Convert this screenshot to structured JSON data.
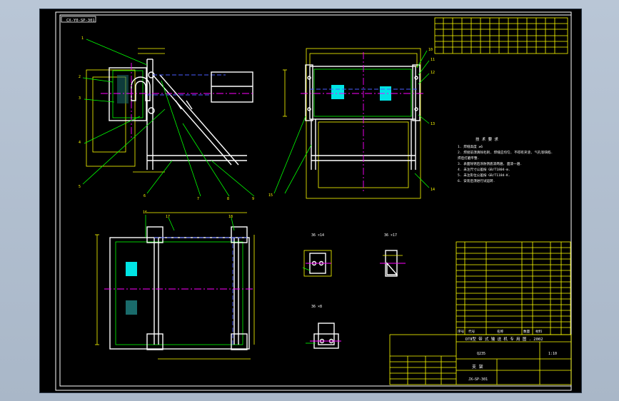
{
  "sheet": {
    "corner_tag": "CX-Y0-SP-301",
    "background": "#000000",
    "frame_color": "#ffffff",
    "line_colors": {
      "outline": "#ffffff",
      "dimension": "#ffff00",
      "hidden": "#4a5cff",
      "center": "#ff00ff",
      "leader": "#00ff00",
      "highlight": "#00e5e5"
    }
  },
  "callouts": {
    "left_view": [
      "1",
      "2",
      "3",
      "4",
      "5",
      "6",
      "7",
      "8",
      "9"
    ],
    "right_view": [
      "10",
      "11",
      "12",
      "13",
      "14",
      "15"
    ],
    "bottom_view": [
      "16",
      "17",
      "18"
    ]
  },
  "details": [
    {
      "label": "36 ×14"
    },
    {
      "label": "36 ×17"
    },
    {
      "label": "36 ×8"
    }
  ],
  "notes": {
    "heading": "技 术 要 求",
    "lines": [
      "1. 焊缝高度 ≥6",
      "2. 焊接前须清除毛刺, 焊缝应均匀, 不得有夹渣, 气孔等缺陷.",
      "   焊后打磨平整.",
      "3. 表面除锈后涂防锈底漆两遍, 面漆一遍.",
      "4. 未注尺寸公差按 GB/T1804-m.",
      "5. 未注形位公差按 GB/T1184-K.",
      "6. 安装后须进行试运转."
    ]
  },
  "title_block": {
    "institution": "DTⅡ型 带 式 输 送 机 专 用 图 . 2002",
    "drawing_title": "支 架",
    "material_label": "Q235",
    "scale_label": "1:10",
    "drawing_number": "JX—SP-301",
    "bom_header": [
      "序号",
      "代号",
      "名称",
      "数量",
      "材料"
    ]
  }
}
